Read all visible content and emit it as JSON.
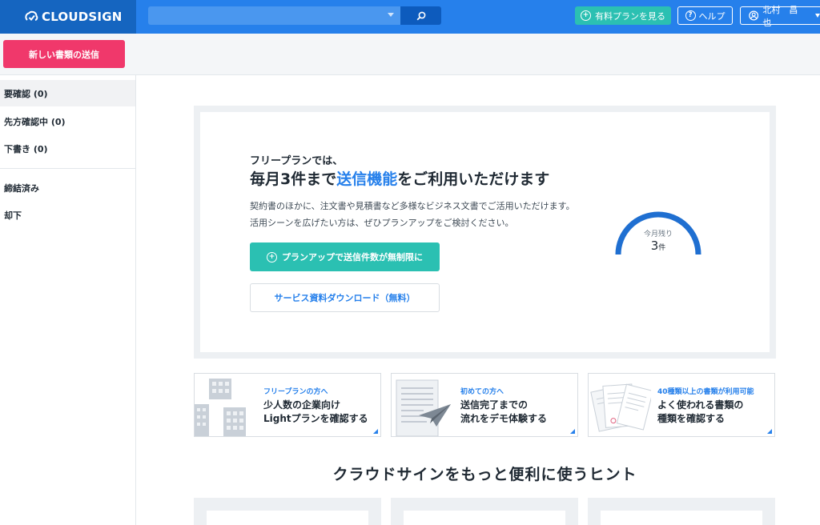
{
  "header": {
    "logo_text": "CLOUDSIGN",
    "search_placeholder": "",
    "plan_button": "有料プランを見る",
    "help_button": "ヘルプ",
    "user_name": "北村　昌也"
  },
  "actions": {
    "send_button": "新しい書類の送信"
  },
  "sidebar": {
    "items": [
      {
        "label": "要確認 (0)"
      },
      {
        "label": "先方確認中 (0)"
      },
      {
        "label": "下書き (0)"
      },
      {
        "label": "締結済み"
      },
      {
        "label": "却下"
      }
    ]
  },
  "promo": {
    "subtitle": "フリープランでは、",
    "title_before": "毎月3件まで",
    "title_highlight": "送信機能",
    "title_after": "をご利用いただけます",
    "description": "契約書のほかに、注文書や見積書など多様なビジネス文書でご活用いただけます。活用シーンを広げたい方は、ぜひプランアップをご検討ください。",
    "upgrade_button": "プランアップで送信件数が無制限に",
    "download_button": "サービス資料ダウンロード（無料）",
    "gauge_label": "今月残り",
    "gauge_value": "3",
    "gauge_unit": "件",
    "gauge_fraction": 1.0
  },
  "cards": [
    {
      "tag": "フリープランの方へ",
      "line1": "少人数の企業向け",
      "line2": "Lightプランを確認する"
    },
    {
      "tag": "初めての方へ",
      "line1": "送信完了までの",
      "line2": "流れをデモ体験する"
    },
    {
      "tag": "40種類以上の書類が利用可能",
      "line1": "よく使われる書類の",
      "line2": "種類を確認する"
    }
  ],
  "hints": {
    "heading": "クラウドサインをもっと便利に使うヒント"
  },
  "colors": {
    "header_blue": "#2680eb",
    "logo_blue": "#1565c0",
    "teal": "#2bc0b2",
    "pink": "#f0386b"
  }
}
